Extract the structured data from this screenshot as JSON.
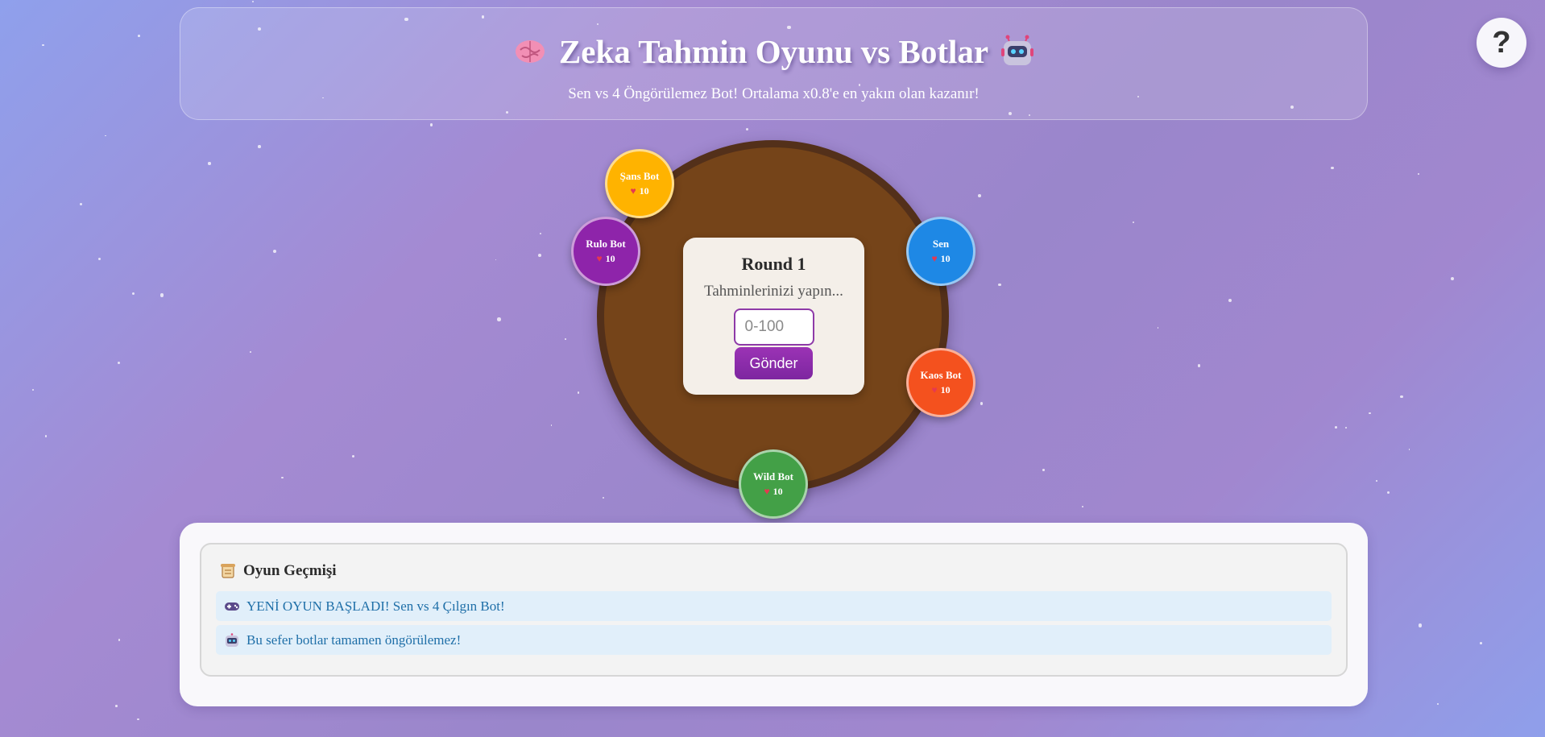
{
  "header": {
    "title": "Zeka Tahmin Oyunu vs Botlar",
    "title_icon_left": "brain-icon",
    "title_icon_right": "robot-icon",
    "subtitle": "Sen vs 4 Öngörülemez Bot! Ortalama x0.8'e en yakın olan kazanır!"
  },
  "help": {
    "label": "?"
  },
  "round": {
    "title": "Round 1",
    "status": "Tahminlerinizi yapın...",
    "input_placeholder": "0-100",
    "input_value": "",
    "submit_label": "Gönder"
  },
  "players": {
    "sans": {
      "name": "Şans Bot",
      "lives": "10",
      "color": "#ffb300"
    },
    "rulo": {
      "name": "Rulo Bot",
      "lives": "10",
      "color": "#8e24aa"
    },
    "sen": {
      "name": "Sen",
      "lives": "10",
      "color": "#1e88e5"
    },
    "kaos": {
      "name": "Kaos Bot",
      "lives": "10",
      "color": "#f4511e"
    },
    "wild": {
      "name": "Wild Bot",
      "lives": "10",
      "color": "#43a047"
    }
  },
  "history": {
    "title": "Oyun Geçmişi",
    "icon": "scroll-icon",
    "entries": [
      {
        "icon": "gamepad-icon",
        "text": "YENİ OYUN BAŞLADI! Sen vs 4 Çılgın Bot!"
      },
      {
        "icon": "robot-icon",
        "text": "Bu sefer botlar tamamen öngörülemez!"
      }
    ]
  },
  "colors": {
    "accent_purple": "#8e3aa8",
    "table_brown": "#754419",
    "log_text_blue": "#1f6fa8"
  }
}
